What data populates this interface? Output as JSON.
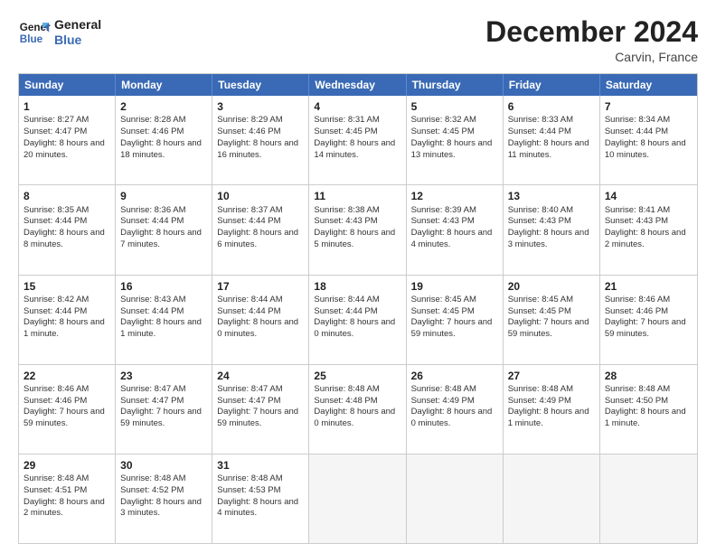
{
  "logo": {
    "line1": "General",
    "line2": "Blue"
  },
  "title": "December 2024",
  "location": "Carvin, France",
  "header_days": [
    "Sunday",
    "Monday",
    "Tuesday",
    "Wednesday",
    "Thursday",
    "Friday",
    "Saturday"
  ],
  "rows": [
    [
      {
        "day": "1",
        "sunrise": "8:27 AM",
        "sunset": "4:47 PM",
        "daylight": "8 hours and 20 minutes."
      },
      {
        "day": "2",
        "sunrise": "8:28 AM",
        "sunset": "4:46 PM",
        "daylight": "8 hours and 18 minutes."
      },
      {
        "day": "3",
        "sunrise": "8:29 AM",
        "sunset": "4:46 PM",
        "daylight": "8 hours and 16 minutes."
      },
      {
        "day": "4",
        "sunrise": "8:31 AM",
        "sunset": "4:45 PM",
        "daylight": "8 hours and 14 minutes."
      },
      {
        "day": "5",
        "sunrise": "8:32 AM",
        "sunset": "4:45 PM",
        "daylight": "8 hours and 13 minutes."
      },
      {
        "day": "6",
        "sunrise": "8:33 AM",
        "sunset": "4:44 PM",
        "daylight": "8 hours and 11 minutes."
      },
      {
        "day": "7",
        "sunrise": "8:34 AM",
        "sunset": "4:44 PM",
        "daylight": "8 hours and 10 minutes."
      }
    ],
    [
      {
        "day": "8",
        "sunrise": "8:35 AM",
        "sunset": "4:44 PM",
        "daylight": "8 hours and 8 minutes."
      },
      {
        "day": "9",
        "sunrise": "8:36 AM",
        "sunset": "4:44 PM",
        "daylight": "8 hours and 7 minutes."
      },
      {
        "day": "10",
        "sunrise": "8:37 AM",
        "sunset": "4:44 PM",
        "daylight": "8 hours and 6 minutes."
      },
      {
        "day": "11",
        "sunrise": "8:38 AM",
        "sunset": "4:43 PM",
        "daylight": "8 hours and 5 minutes."
      },
      {
        "day": "12",
        "sunrise": "8:39 AM",
        "sunset": "4:43 PM",
        "daylight": "8 hours and 4 minutes."
      },
      {
        "day": "13",
        "sunrise": "8:40 AM",
        "sunset": "4:43 PM",
        "daylight": "8 hours and 3 minutes."
      },
      {
        "day": "14",
        "sunrise": "8:41 AM",
        "sunset": "4:43 PM",
        "daylight": "8 hours and 2 minutes."
      }
    ],
    [
      {
        "day": "15",
        "sunrise": "8:42 AM",
        "sunset": "4:44 PM",
        "daylight": "8 hours and 1 minute."
      },
      {
        "day": "16",
        "sunrise": "8:43 AM",
        "sunset": "4:44 PM",
        "daylight": "8 hours and 1 minute."
      },
      {
        "day": "17",
        "sunrise": "8:44 AM",
        "sunset": "4:44 PM",
        "daylight": "8 hours and 0 minutes."
      },
      {
        "day": "18",
        "sunrise": "8:44 AM",
        "sunset": "4:44 PM",
        "daylight": "8 hours and 0 minutes."
      },
      {
        "day": "19",
        "sunrise": "8:45 AM",
        "sunset": "4:45 PM",
        "daylight": "7 hours and 59 minutes."
      },
      {
        "day": "20",
        "sunrise": "8:45 AM",
        "sunset": "4:45 PM",
        "daylight": "7 hours and 59 minutes."
      },
      {
        "day": "21",
        "sunrise": "8:46 AM",
        "sunset": "4:46 PM",
        "daylight": "7 hours and 59 minutes."
      }
    ],
    [
      {
        "day": "22",
        "sunrise": "8:46 AM",
        "sunset": "4:46 PM",
        "daylight": "7 hours and 59 minutes."
      },
      {
        "day": "23",
        "sunrise": "8:47 AM",
        "sunset": "4:47 PM",
        "daylight": "7 hours and 59 minutes."
      },
      {
        "day": "24",
        "sunrise": "8:47 AM",
        "sunset": "4:47 PM",
        "daylight": "7 hours and 59 minutes."
      },
      {
        "day": "25",
        "sunrise": "8:48 AM",
        "sunset": "4:48 PM",
        "daylight": "8 hours and 0 minutes."
      },
      {
        "day": "26",
        "sunrise": "8:48 AM",
        "sunset": "4:49 PM",
        "daylight": "8 hours and 0 minutes."
      },
      {
        "day": "27",
        "sunrise": "8:48 AM",
        "sunset": "4:49 PM",
        "daylight": "8 hours and 1 minute."
      },
      {
        "day": "28",
        "sunrise": "8:48 AM",
        "sunset": "4:50 PM",
        "daylight": "8 hours and 1 minute."
      }
    ],
    [
      {
        "day": "29",
        "sunrise": "8:48 AM",
        "sunset": "4:51 PM",
        "daylight": "8 hours and 2 minutes."
      },
      {
        "day": "30",
        "sunrise": "8:48 AM",
        "sunset": "4:52 PM",
        "daylight": "8 hours and 3 minutes."
      },
      {
        "day": "31",
        "sunrise": "8:48 AM",
        "sunset": "4:53 PM",
        "daylight": "8 hours and 4 minutes."
      },
      null,
      null,
      null,
      null
    ]
  ]
}
